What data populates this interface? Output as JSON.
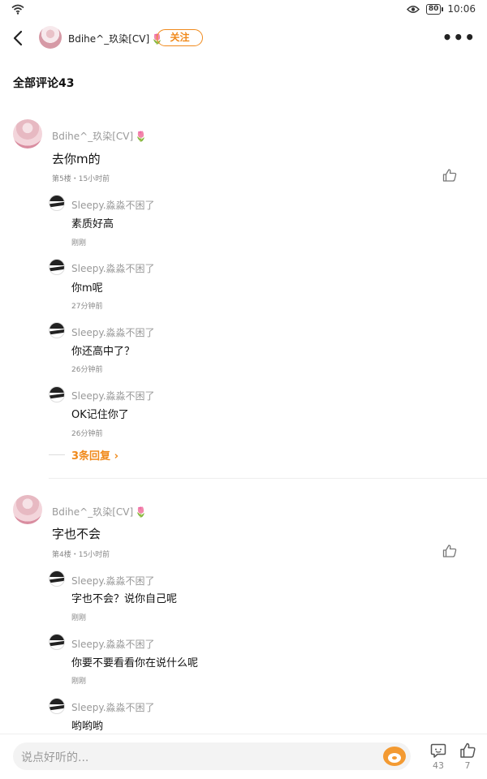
{
  "status": {
    "battery": "80",
    "time": "10:06"
  },
  "nav": {
    "user_name": "Bdihe^_玖染[CV]",
    "follow_label": "关注"
  },
  "section": {
    "title": "全部评论43"
  },
  "comments": [
    {
      "name": "Bdihe^_玖染[CV]",
      "text": "去你m的",
      "meta": "第5楼・15小时前",
      "replies": [
        {
          "name": "Sleepy.淼淼不困了",
          "text": "素质好高",
          "time": "刚刚"
        },
        {
          "name": "Sleepy.淼淼不困了",
          "text": "你m呢",
          "time": "27分钟前"
        },
        {
          "name": "Sleepy.淼淼不困了",
          "text": "你还高中了？",
          "time": "26分钟前"
        },
        {
          "name": "Sleepy.淼淼不困了",
          "text": "OK记住你了",
          "time": "26分钟前"
        }
      ],
      "more_replies": "3条回复"
    },
    {
      "name": "Bdihe^_玖染[CV]",
      "text": "字也不会",
      "meta": "第4楼・15小时前",
      "replies": [
        {
          "name": "Sleepy.淼淼不困了",
          "text": "字也不会？说你自己呢",
          "time": "刚刚"
        },
        {
          "name": "Sleepy.淼淼不困了",
          "text": "你要不要看看你在说什么呢",
          "time": "刚刚"
        },
        {
          "name": "Sleepy.淼淼不困了",
          "text": "哟哟哟",
          "time": ""
        }
      ]
    }
  ],
  "bottom": {
    "placeholder": "说点好听的...",
    "comment_count": "43",
    "like_count": "7"
  },
  "icons": {
    "back": "back-arrow-icon",
    "more": "more-dots-icon",
    "like": "thumbs-up-icon",
    "comment": "comment-bubble-icon",
    "wifi": "wifi-icon",
    "eye": "eye-icon",
    "battery": "battery-icon",
    "mascot": "mascot-icon"
  },
  "colors": {
    "accent": "#f08a1c",
    "secondary_text": "#999999"
  }
}
